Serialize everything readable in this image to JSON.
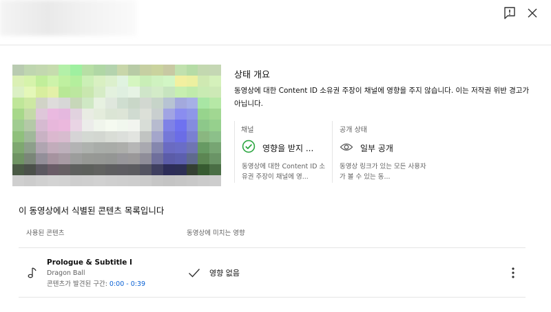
{
  "header": {
    "report_icon": "report-flag-icon",
    "close_icon": "close-icon"
  },
  "thumbnail": {
    "pixels": [
      [
        "#b9cbb1",
        "#bfd6b0",
        "#c3d8b0",
        "#c6dcae",
        "#b3f0a8",
        "#9ff0a0",
        "#b7dfa5",
        "#b0d7a5",
        "#b4d3ae",
        "#c8d6aa",
        "#b8cba6",
        "#c6cfa2",
        "#cad39e",
        "#c8c9a3",
        "#c1e1ae",
        "#b6dca6",
        "#c3d8b0",
        "#c5d7b4"
      ],
      [
        "#dbf0b5",
        "#d6f3ab",
        "#c1ee9a",
        "#cdf3aa",
        "#bff0a0",
        "#b4ef9d",
        "#cbefb6",
        "#d9f0c2",
        "#dcf0cd",
        "#e0f3e0",
        "#d5f6c0",
        "#c9eeb7",
        "#cff2c0",
        "#d2f6c5",
        "#f2f0a0",
        "#ecf0a0",
        "#cfe9b2",
        "#d5f1bb"
      ],
      [
        "#dbf0c4",
        "#e4f7b8",
        "#d8ee9e",
        "#e3f0a8",
        "#b8e896",
        "#bce79f",
        "#c9e7af",
        "#d6ecc6",
        "#e3f1de",
        "#dfefe0",
        "#e6f3e4",
        "#cfe5c9",
        "#d3ebc8",
        "#c7e4bf",
        "#c7efb0",
        "#c0ebab",
        "#c9ebb3",
        "#cde9b6"
      ],
      [
        "#bfe699",
        "#cde8a3",
        "#d1d3c7",
        "#dedcdb",
        "#d7d7d7",
        "#c7d7b9",
        "#cfe8c4",
        "#e7f1e1",
        "#dfe7dd",
        "#cfded0",
        "#c9d7c8",
        "#d2d8d1",
        "#c7d4c9",
        "#b7c3d3",
        "#a3a9dd",
        "#a6b0e6",
        "#a8e6a4",
        "#b6e8a6"
      ],
      [
        "#a7d88a",
        "#c4daa8",
        "#dfc7da",
        "#eab9e0",
        "#e5b8df",
        "#e1d2df",
        "#e9ece3",
        "#e4ecdc",
        "#dbe5d5",
        "#dde5d7",
        "#d0dbd1",
        "#dce0d8",
        "#c9cfcf",
        "#a1a4e3",
        "#8a8df0",
        "#8e97e8",
        "#97d48d",
        "#a1d792"
      ],
      [
        "#a0cc91",
        "#b4c9a7",
        "#d6bad1",
        "#e7b7db",
        "#ebb8dd",
        "#e9d4e4",
        "#ececea",
        "#f0f5ec",
        "#f5faf0",
        "#f1f7ee",
        "#f2f4ef",
        "#d8ddd7",
        "#b7bbcf",
        "#7f82e6",
        "#6f72f0",
        "#848cdf",
        "#8dc88a",
        "#96d08d"
      ],
      [
        "#8fc07c",
        "#a0b89a",
        "#c9b2c4",
        "#dbb8cf",
        "#d8bccf",
        "#d6d4d6",
        "#d4d9d3",
        "#d3d7d1",
        "#d9ddd6",
        "#dcdfdb",
        "#e2e4e0",
        "#c1c4c2",
        "#a4a6cb",
        "#7578d8",
        "#6b6de6",
        "#7a80d2",
        "#8ab780",
        "#8cc08a"
      ],
      [
        "#7ea870",
        "#8d9f8b",
        "#b0a5b1",
        "#c2acbb",
        "#bdb0bb",
        "#b3b3b4",
        "#aeb2ae",
        "#a9ada9",
        "#a9aca8",
        "#adaeab",
        "#b6b6b6",
        "#a9a9b0",
        "#8587ae",
        "#6a6bc2",
        "#6a6dc7",
        "#6f75b3",
        "#679a63",
        "#77a573"
      ],
      [
        "#6f9463",
        "#7a8678",
        "#938f99",
        "#a6939f",
        "#a89ba4",
        "#9c9d9c",
        "#979995",
        "#969895",
        "#949694",
        "#98979b",
        "#9a9899",
        "#8f8d99",
        "#6f6f9c",
        "#5b5ca8",
        "#5c5fae",
        "#5f6a8e",
        "#5c8653",
        "#6a9466"
      ],
      [
        "#4a5a45",
        "#4b504a",
        "#5b5860",
        "#6a5c67",
        "#676064",
        "#5e605e",
        "#5d605c",
        "#616260",
        "#5e5e60",
        "#5e5d62",
        "#5c5c60",
        "#545462",
        "#3f3f60",
        "#2d2d58",
        "#2d2f55",
        "#344032",
        "#375b31",
        "#4a6e45"
      ],
      [
        "#cfcfcf",
        "#cccccc",
        "#d0d0d0",
        "#d3d3d3",
        "#d2d2d2",
        "#cecece",
        "#cfcfcf",
        "#d1d1d1",
        "#cfcfcf",
        "#cecece",
        "#cdcdcd",
        "#cbcbcb",
        "#c6c6c6",
        "#c4c4c4",
        "#c6c6c6",
        "#c8c8c8",
        "#cbcbcb",
        "#cdcdcd"
      ]
    ]
  },
  "status": {
    "title": "상태 개요",
    "description": "동영상에 대한 Content ID 소유권 주장이 채널에 영향을 주지 않습니다. 이는 저작권 위반 경고가 아닙니다."
  },
  "channel": {
    "label": "채널",
    "value": "영향을 받지 ...",
    "detail": "동영상에 대한 Content ID 소유권 주장이 채널에 영...",
    "icon": "check-circle-icon",
    "icon_color": "#2ba640"
  },
  "visibility": {
    "label": "공개 상태",
    "value": "일부 공개",
    "detail": "동영상 링크가 있는 모든 사용자가 볼 수 있는 동...",
    "icon": "eye-icon"
  },
  "content_list": {
    "title": "이 동영상에서 식별된 콘텐츠 목록입니다",
    "col_used": "사용된 콘텐츠",
    "col_impact": "동영상에 미치는 영향",
    "items": [
      {
        "icon": "music-note-icon",
        "title": "Prologue & Subtitle I",
        "artist": "Dragon Ball",
        "found_label": "콘텐츠가 발견된 구간: ",
        "found_time": "0:00 - 0:39",
        "impact_icon": "checkmark-icon",
        "impact": "영향 없음",
        "menu_icon": "more-vert-icon"
      }
    ]
  },
  "colors": {
    "link": "#065fd4",
    "secondary_text": "#606060",
    "divider": "#e5e5e5"
  }
}
